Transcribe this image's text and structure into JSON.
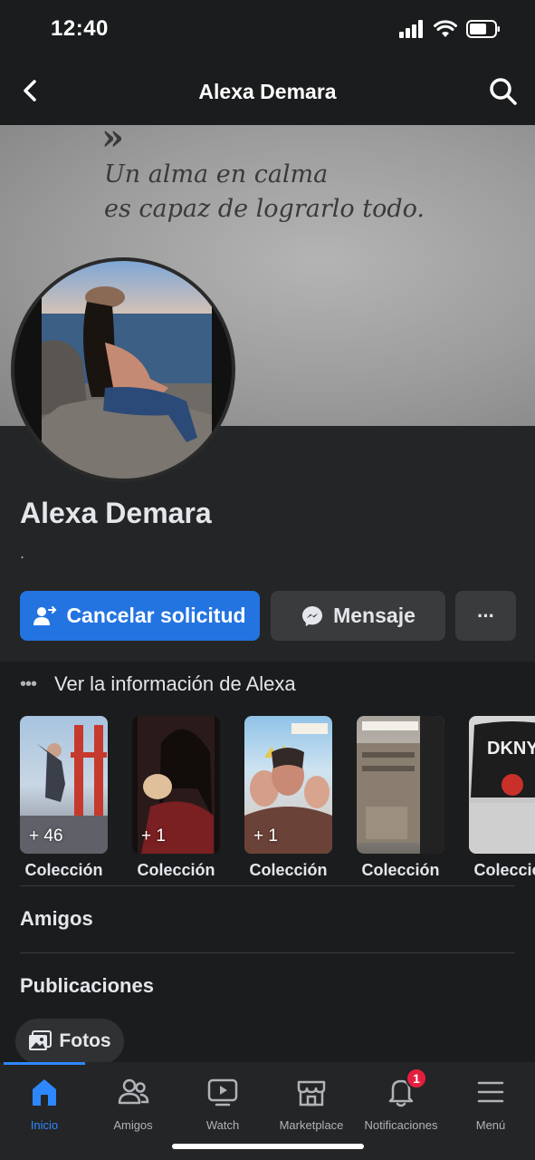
{
  "status_bar": {
    "time": "12:40"
  },
  "header": {
    "title": "Alexa Demara",
    "back_icon": "back-arrow-icon",
    "search_icon": "search-icon"
  },
  "cover": {
    "quote_line1": "Un alma en calma",
    "quote_line2": "es capaz de lograrlo todo."
  },
  "profile": {
    "name": "Alexa Demara",
    "bio": ".",
    "buttons": {
      "cancel_request": "Cancelar solicitud",
      "message": "Mensaje",
      "more": "···"
    }
  },
  "info": {
    "label": "Ver la información de Alexa"
  },
  "highlights": [
    {
      "label": "Colección",
      "count": "+ 46"
    },
    {
      "label": "Colección",
      "count": "+ 1"
    },
    {
      "label": "Colección",
      "count": "+ 1"
    },
    {
      "label": "Colección",
      "count": ""
    },
    {
      "label": "Colección",
      "count": ""
    }
  ],
  "sections": {
    "friends": "Amigos",
    "posts": "Publicaciones",
    "photos_chip": "Fotos"
  },
  "tabbar": {
    "items": [
      {
        "label": "Inicio",
        "icon": "home-icon",
        "active": true
      },
      {
        "label": "Amigos",
        "icon": "friends-icon"
      },
      {
        "label": "Watch",
        "icon": "watch-icon"
      },
      {
        "label": "Marketplace",
        "icon": "marketplace-icon"
      },
      {
        "label": "Notificaciones",
        "icon": "bell-icon",
        "badge": "1"
      },
      {
        "label": "Menú",
        "icon": "menu-icon"
      }
    ]
  },
  "colors": {
    "accent": "#2374e1",
    "tab_active": "#2d88ff",
    "badge": "#e41e3f"
  }
}
